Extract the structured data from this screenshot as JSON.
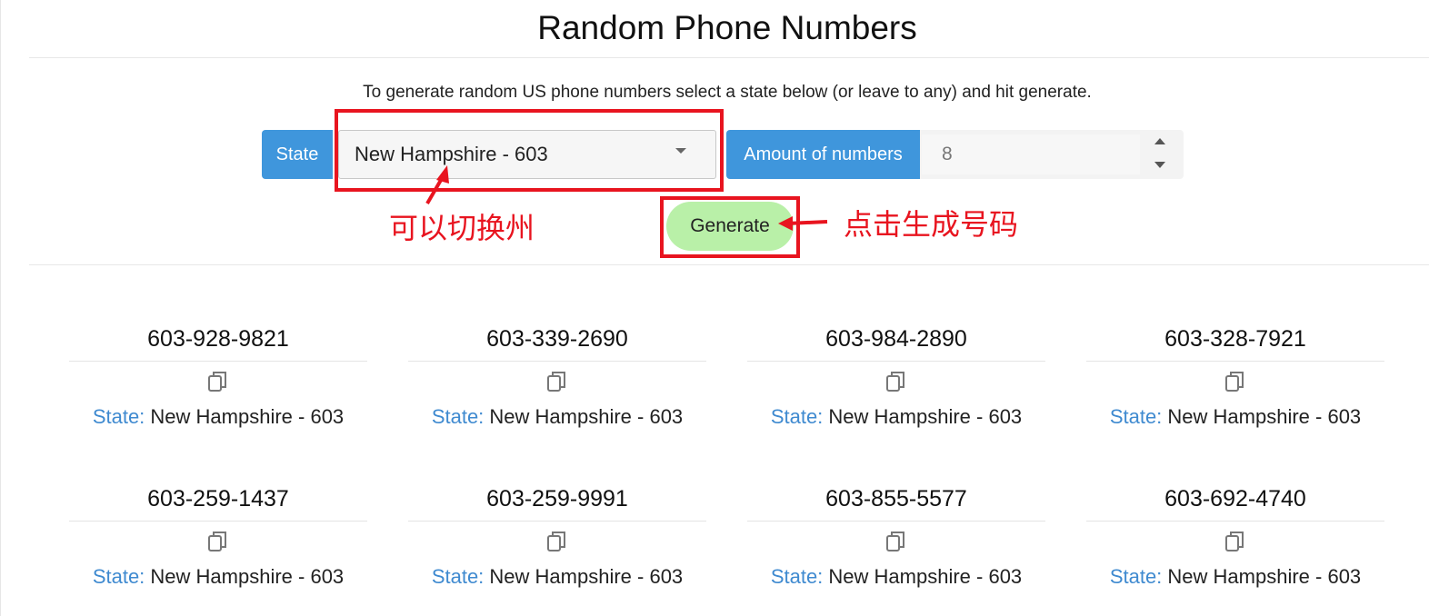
{
  "title": "Random Phone Numbers",
  "intro": "To generate random US phone numbers select a state below (or leave to any) and hit generate.",
  "form": {
    "state_label": "State",
    "state_value": "New Hampshire - 603",
    "amount_label": "Amount of numbers",
    "amount_value": "8",
    "generate_label": "Generate"
  },
  "annotations": {
    "state_hint": "可以切换州",
    "generate_hint": "点击生成号码",
    "color": "#e8141f"
  },
  "results": {
    "state_key": "State:",
    "items": [
      {
        "number": "603-928-9821",
        "state": "New Hampshire - 603"
      },
      {
        "number": "603-339-2690",
        "state": "New Hampshire - 603"
      },
      {
        "number": "603-984-2890",
        "state": "New Hampshire - 603"
      },
      {
        "number": "603-328-7921",
        "state": "New Hampshire - 603"
      },
      {
        "number": "603-259-1437",
        "state": "New Hampshire - 603"
      },
      {
        "number": "603-259-9991",
        "state": "New Hampshire - 603"
      },
      {
        "number": "603-855-5577",
        "state": "New Hampshire - 603"
      },
      {
        "number": "603-692-4740",
        "state": "New Hampshire - 603"
      }
    ]
  },
  "colors": {
    "accent": "#3f96dc",
    "generate_bg": "#b9f0a8",
    "state_key": "#3f8ad0"
  },
  "icons": {
    "copy": "copy-icon",
    "select_caret": "chevron-down-icon",
    "spin_up": "spin-up-icon",
    "spin_down": "spin-down-icon"
  }
}
